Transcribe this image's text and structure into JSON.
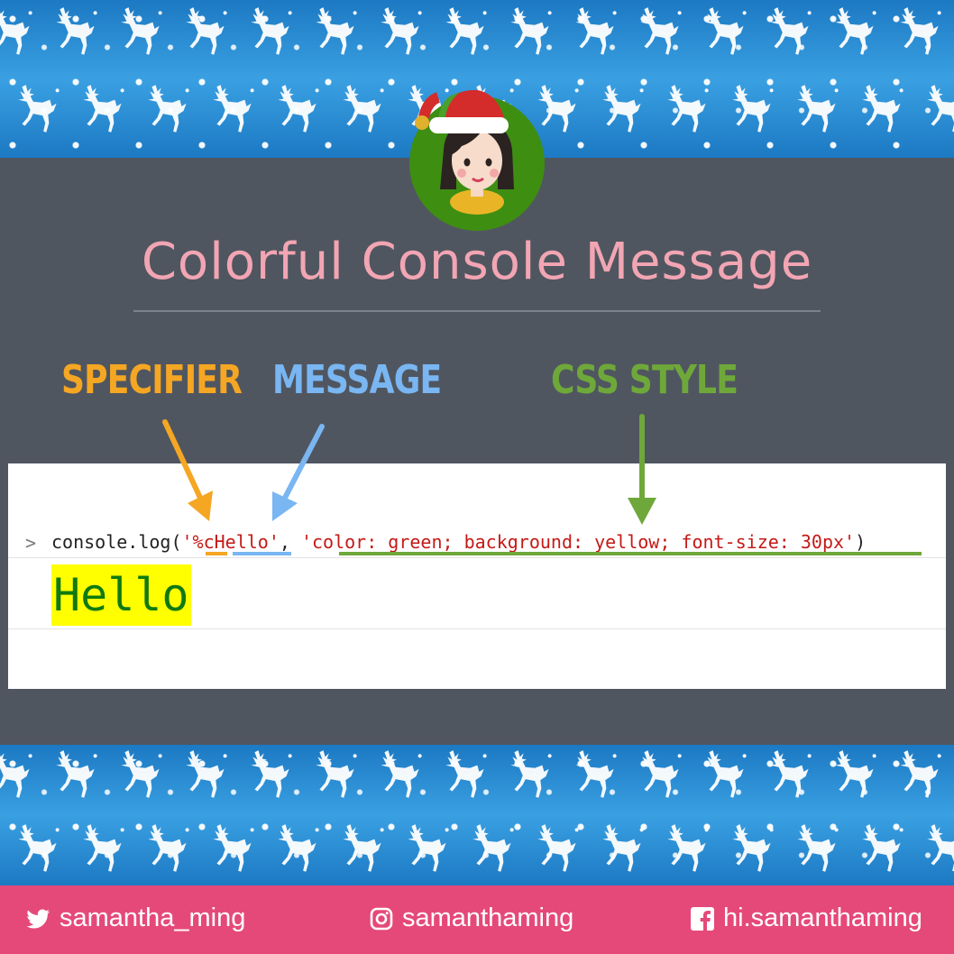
{
  "title": "Colorful Console Message",
  "labels": {
    "specifier": "SPECIFIER",
    "message": "MESSAGE",
    "css_style": "CSS STYLE"
  },
  "colors": {
    "specifier": "#f5a623",
    "message": "#79b6f2",
    "css_style": "#6fa83a",
    "title": "#f2a5b3",
    "footer": "#e5497a",
    "panel": "#505660",
    "pattern": "#2d8fd6"
  },
  "console": {
    "prompt": ">",
    "code": {
      "prefix": "console.log(",
      "specifier_string": "'%cHello'",
      "separator": ", ",
      "style_string": "'color: green; background: yellow; font-size: 30px'",
      "suffix": ")"
    },
    "output": "Hello"
  },
  "footer": {
    "twitter": "samantha_ming",
    "instagram": "samanthaming",
    "facebook": "hi.samanthaming"
  },
  "icons": {
    "twitter": "twitter-icon",
    "instagram": "instagram-icon",
    "facebook": "facebook-icon",
    "avatar": "elf-avatar",
    "decor": "reindeer-icon"
  }
}
